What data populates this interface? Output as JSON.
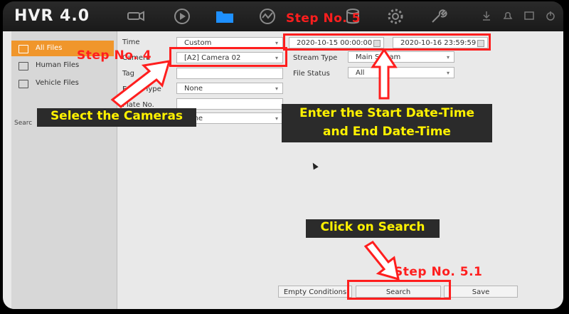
{
  "app": {
    "title": "HVR 4.0"
  },
  "topnav": {
    "icons": [
      "camera-icon",
      "playback-icon",
      "folder-icon",
      "chart-icon",
      "database-icon",
      "gear-icon",
      "wrench-icon"
    ],
    "right_icons": [
      "download-icon",
      "bell-icon",
      "minimize-icon",
      "power-icon"
    ]
  },
  "sidebar": {
    "items": [
      {
        "label": "All Files"
      },
      {
        "label": "Human Files"
      },
      {
        "label": "Vehicle Files"
      }
    ],
    "search_stub": "Searc"
  },
  "form": {
    "time": {
      "label": "Time",
      "value": "Custom"
    },
    "camera": {
      "label": "Camera",
      "value": "[A2] Camera 02"
    },
    "tag": {
      "label": "Tag"
    },
    "event_type": {
      "label": "Event Type",
      "value": "None"
    },
    "plate_no": {
      "label": "Plate No."
    },
    "last": {
      "value": "None"
    },
    "start_datetime": "2020-10-15 00:00:00",
    "end_datetime": "2020-10-16 23:59:59",
    "stream_type": {
      "label": "Stream Type",
      "value": "Main Stream"
    },
    "file_status": {
      "label": "File Status",
      "value": "All"
    }
  },
  "buttons": {
    "empty_condition": "Empty Conditions",
    "search": "Search",
    "save": "Save"
  },
  "annotations": {
    "step4": "Step No. 4",
    "step5": "Step No. 5",
    "step51": "Step No. 5.1",
    "select_cameras": "Select the Cameras",
    "enter_dates_line1": "Enter the Start Date-Time",
    "enter_dates_line2": "and End Date-Time",
    "click_search": "Click on Search"
  },
  "colors": {
    "accent": "#f0962b",
    "annotation_red": "#ff1e1e",
    "callout_text": "#fff200",
    "callout_bg": "#2b2b2b",
    "nav_active": "#1e90ff"
  }
}
